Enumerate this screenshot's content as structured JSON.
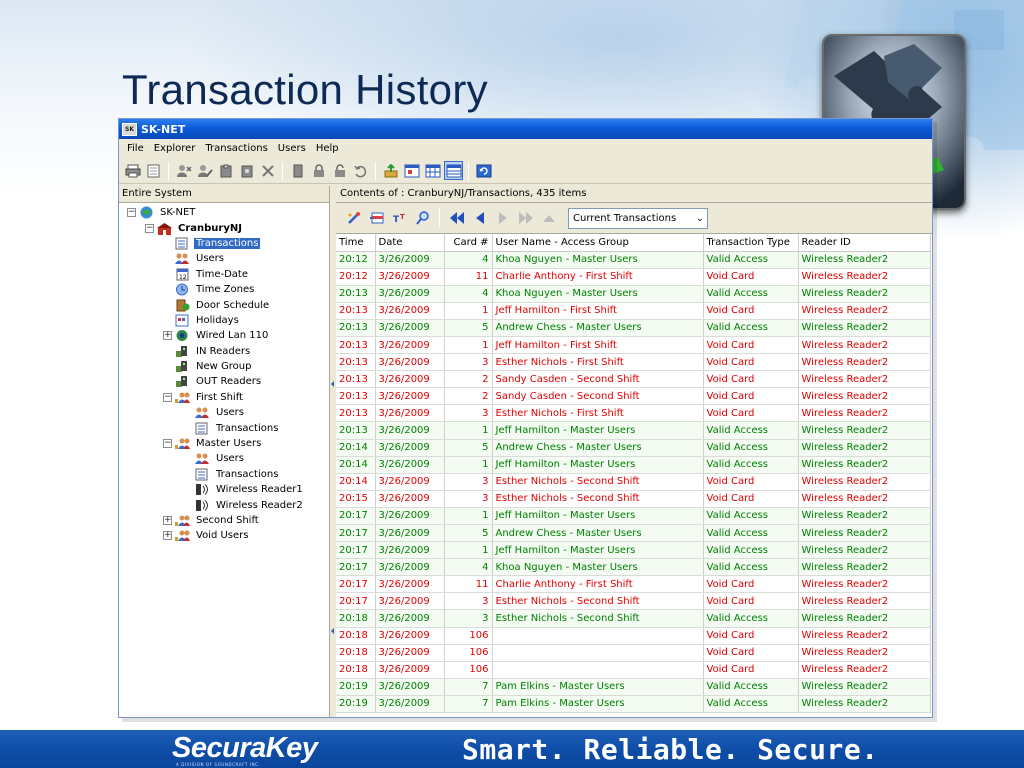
{
  "slide": {
    "title": "Transaction History"
  },
  "window": {
    "title": "SK-NET",
    "icon_text": "SK"
  },
  "menu": [
    "File",
    "Explorer",
    "Transactions",
    "Users",
    "Help"
  ],
  "tree": {
    "header": "Entire System",
    "root": "SK-NET",
    "site": "CranburyNJ",
    "items": {
      "transactions": "Transactions",
      "users": "Users",
      "time_date": "Time-Date",
      "time_zones": "Time Zones",
      "door_schedule": "Door Schedule",
      "holidays": "Holidays",
      "wired_lan": "Wired Lan 110",
      "in_readers": "IN Readers",
      "new_group": "New Group",
      "out_readers": "OUT Readers",
      "first_shift": "First Shift",
      "first_shift_users": "Users",
      "first_shift_transactions": "Transactions",
      "master_users": "Master Users",
      "master_users_users": "Users",
      "master_users_transactions": "Transactions",
      "wireless_reader1": "Wireless Reader1",
      "wireless_reader2": "Wireless Reader2",
      "second_shift": "Second Shift",
      "void_users": "Void Users"
    }
  },
  "contents": {
    "header": "Contents of : CranburyNJ/Transactions, 435  items",
    "filter_value": "Current Transactions"
  },
  "table": {
    "columns": [
      "Time",
      "Date",
      "Card #",
      "User Name - Access Group",
      "Transaction Type",
      "Reader ID"
    ],
    "rows": [
      [
        "20:12",
        "3/26/2009",
        "4",
        "Khoa Nguyen - Master Users",
        "Valid Access",
        "Wireless Reader2"
      ],
      [
        "20:12",
        "3/26/2009",
        "11",
        "Charlie Anthony - First Shift",
        "Void Card",
        "Wireless Reader2"
      ],
      [
        "20:13",
        "3/26/2009",
        "4",
        "Khoa Nguyen - Master Users",
        "Valid Access",
        "Wireless Reader2"
      ],
      [
        "20:13",
        "3/26/2009",
        "1",
        "Jeff Hamilton - First Shift",
        "Void Card",
        "Wireless Reader2"
      ],
      [
        "20:13",
        "3/26/2009",
        "5",
        "Andrew Chess - Master Users",
        "Valid Access",
        "Wireless Reader2"
      ],
      [
        "20:13",
        "3/26/2009",
        "1",
        "Jeff Hamilton - First Shift",
        "Void Card",
        "Wireless Reader2"
      ],
      [
        "20:13",
        "3/26/2009",
        "3",
        "Esther Nichols - First Shift",
        "Void Card",
        "Wireless Reader2"
      ],
      [
        "20:13",
        "3/26/2009",
        "2",
        "Sandy Casden - Second Shift",
        "Void Card",
        "Wireless Reader2"
      ],
      [
        "20:13",
        "3/26/2009",
        "2",
        "Sandy Casden - Second Shift",
        "Void Card",
        "Wireless Reader2"
      ],
      [
        "20:13",
        "3/26/2009",
        "3",
        "Esther Nichols - First Shift",
        "Void Card",
        "Wireless Reader2"
      ],
      [
        "20:13",
        "3/26/2009",
        "1",
        "Jeff Hamilton - Master Users",
        "Valid Access",
        "Wireless Reader2"
      ],
      [
        "20:14",
        "3/26/2009",
        "5",
        "Andrew Chess - Master Users",
        "Valid Access",
        "Wireless Reader2"
      ],
      [
        "20:14",
        "3/26/2009",
        "1",
        "Jeff Hamilton - Master Users",
        "Valid Access",
        "Wireless Reader2"
      ],
      [
        "20:14",
        "3/26/2009",
        "3",
        "Esther Nichols - Second Shift",
        "Void Card",
        "Wireless Reader2"
      ],
      [
        "20:15",
        "3/26/2009",
        "3",
        "Esther Nichols - Second Shift",
        "Void Card",
        "Wireless Reader2"
      ],
      [
        "20:17",
        "3/26/2009",
        "1",
        "Jeff Hamilton - Master Users",
        "Valid Access",
        "Wireless Reader2"
      ],
      [
        "20:17",
        "3/26/2009",
        "5",
        "Andrew Chess - Master Users",
        "Valid Access",
        "Wireless Reader2"
      ],
      [
        "20:17",
        "3/26/2009",
        "1",
        "Jeff Hamilton - Master Users",
        "Valid Access",
        "Wireless Reader2"
      ],
      [
        "20:17",
        "3/26/2009",
        "4",
        "Khoa Nguyen - Master Users",
        "Valid Access",
        "Wireless Reader2"
      ],
      [
        "20:17",
        "3/26/2009",
        "11",
        "Charlie Anthony - First Shift",
        "Void Card",
        "Wireless Reader2"
      ],
      [
        "20:17",
        "3/26/2009",
        "3",
        "Esther Nichols - Second Shift",
        "Void Card",
        "Wireless Reader2"
      ],
      [
        "20:18",
        "3/26/2009",
        "3",
        "Esther Nichols - Second Shift",
        "Valid Access",
        "Wireless Reader2"
      ],
      [
        "20:18",
        "3/26/2009",
        "106",
        "",
        "Void Card",
        "Wireless Reader2"
      ],
      [
        "20:18",
        "3/26/2009",
        "106",
        "",
        "Void Card",
        "Wireless Reader2"
      ],
      [
        "20:18",
        "3/26/2009",
        "106",
        "",
        "Void Card",
        "Wireless Reader2"
      ],
      [
        "20:19",
        "3/26/2009",
        "7",
        "Pam Elkins - Master Users",
        "Valid Access",
        "Wireless Reader2"
      ],
      [
        "20:19",
        "3/26/2009",
        "7",
        "Pam Elkins - Master Users",
        "Valid Access",
        "Wireless Reader2"
      ]
    ]
  },
  "colors": {
    "valid_access": "#008000",
    "void_card": "#e00000",
    "selection": "#316ac5",
    "title_bar": "#0b5bd8",
    "footer": "#0e4ea8"
  },
  "icons": {
    "toolbar": [
      "print-icon",
      "preview-icon",
      "user-add-icon",
      "user-edit-icon",
      "clipboard-icon",
      "clipboard-user-icon",
      "delete-icon",
      "door-icon",
      "lock-icon",
      "unlock-icon",
      "undo-icon",
      "export-icon",
      "window-icon",
      "grid-icon",
      "table-icon",
      "refresh-icon"
    ],
    "sub_toolbar": [
      "wand-icon",
      "add-row-icon",
      "font-size-icon",
      "find-icon",
      "first-icon",
      "previous-icon",
      "next-icon",
      "last-icon",
      "up-icon"
    ]
  },
  "footer": {
    "brand": "SecuraKey",
    "brand_sub": "A DIVISION OF SOUNDCRAFT INC.",
    "tagline": "Smart. Reliable. Secure."
  }
}
